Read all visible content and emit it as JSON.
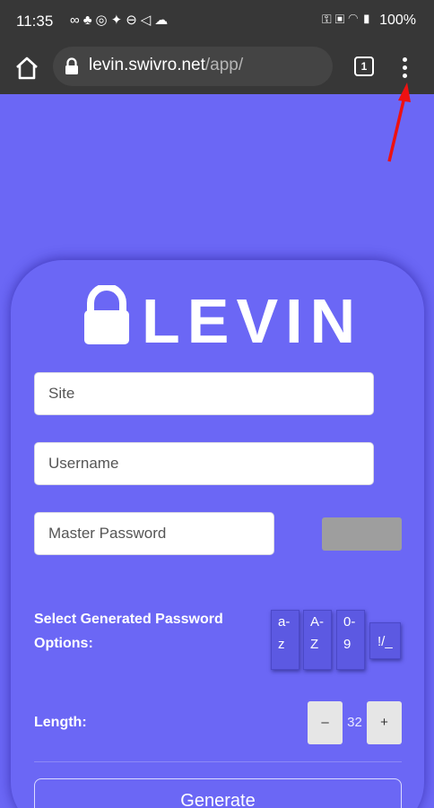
{
  "status_bar": {
    "time": "11:35",
    "left_icons": [
      "voicemail-icon",
      "tidal-icon",
      "instagram-icon",
      "twitter-icon",
      "dnd-icon",
      "signal-icon",
      "cloud-icon"
    ],
    "right_icons": [
      "vpn-key-icon",
      "lock-badge-icon",
      "wifi-icon",
      "signal-bars-icon"
    ],
    "battery": "100%"
  },
  "browser": {
    "url_host": "levin.swivro.net",
    "url_path": "/app/",
    "tab_count": "1"
  },
  "app": {
    "logo_text": "LEVIN",
    "site_placeholder": "Site",
    "username_placeholder": "Username",
    "master_password_placeholder": "Master Password",
    "options_label": "Select Generated Password Options:",
    "options": [
      {
        "top": "a-",
        "bottom": "z"
      },
      {
        "top": "A-",
        "bottom": "Z"
      },
      {
        "top": "0-",
        "bottom": "9"
      },
      {
        "top": "!/_",
        "bottom": ""
      }
    ],
    "length_label": "Length:",
    "length_minus": "–",
    "length_value": "32",
    "length_plus": "+",
    "generate_label": "Generate"
  },
  "colors": {
    "background": "#6b67f5",
    "chrome_bar": "#373737",
    "arrow": "#ee1111"
  }
}
